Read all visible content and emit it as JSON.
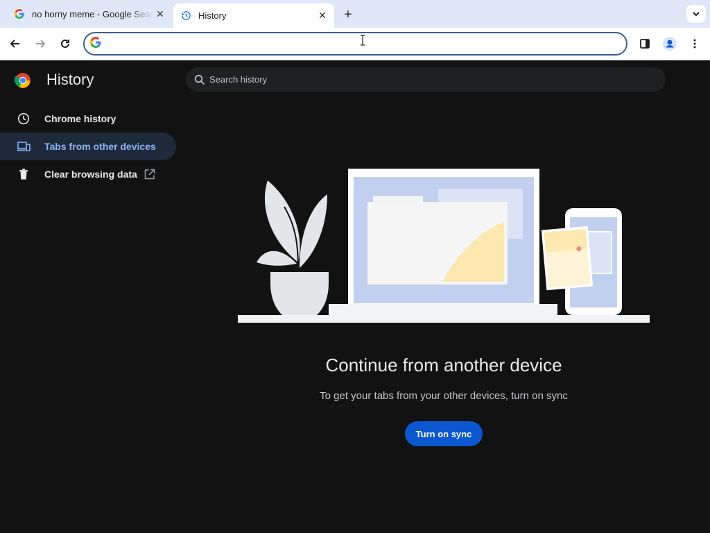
{
  "tabs": [
    {
      "title": "no horny meme - Google Search",
      "favicon": "google-g-icon",
      "close_label": "✕"
    },
    {
      "title": "History",
      "favicon": "history-icon",
      "close_label": "✕",
      "active": true
    }
  ],
  "newtab_label": "+",
  "omnibox": {
    "value": "",
    "placeholder": ""
  },
  "history": {
    "title": "History",
    "search_placeholder": "Search history",
    "nav": [
      {
        "label": "Chrome history",
        "icon": "clock-icon"
      },
      {
        "label": "Tabs from other devices",
        "icon": "devices-icon",
        "selected": true
      },
      {
        "label": "Clear browsing data",
        "icon": "trash-icon",
        "trailing_icon": "open-in-new-icon"
      }
    ],
    "empty_state": {
      "heading": "Continue from another device",
      "subtext": "To get your tabs from your other devices, turn on sync",
      "button_label": "Turn on sync"
    }
  },
  "colors": {
    "tabstrip": "#dfe7f8",
    "page_bg": "#121212",
    "accent": "#8ab4f8",
    "button": "#0b57d0"
  }
}
